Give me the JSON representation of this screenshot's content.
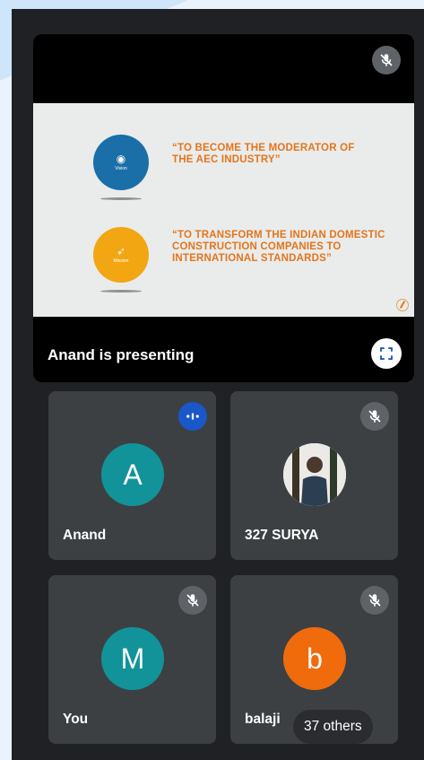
{
  "presentation": {
    "presenter_label": "Anand is presenting",
    "slide": {
      "vision_circle_label": "Vision",
      "mission_circle_label": "Mission",
      "vision_quote": "“TO BECOME THE MODERATOR OF THE AEC INDUSTRY”",
      "mission_quote": "“TO TRANSFORM THE INDIAN DOMESTIC CONSTRUCTION COMPANIES TO INTERNATIONAL STANDARDS”"
    }
  },
  "participants": [
    {
      "name": "Anand",
      "initial": "A",
      "status": "speaking",
      "avatar_color": "#12939a"
    },
    {
      "name": "327 SURYA",
      "initial": "",
      "status": "muted",
      "avatar": "photo"
    },
    {
      "name": "You",
      "initial": "M",
      "status": "muted",
      "avatar_color": "#12939a"
    },
    {
      "name": "balaji",
      "initial": "b",
      "status": "muted",
      "avatar_color": "#f06b0c"
    }
  ],
  "others_label": "37 others",
  "icons": {
    "muted": "mic-off-icon",
    "speaking": "audio-level-icon",
    "fullscreen": "fullscreen-icon"
  },
  "colors": {
    "background": "#202124",
    "tile": "#3c4043",
    "speaking_badge": "#1a57c8",
    "mute_badge": "#5f6368",
    "slide_text": "#e4751c"
  }
}
